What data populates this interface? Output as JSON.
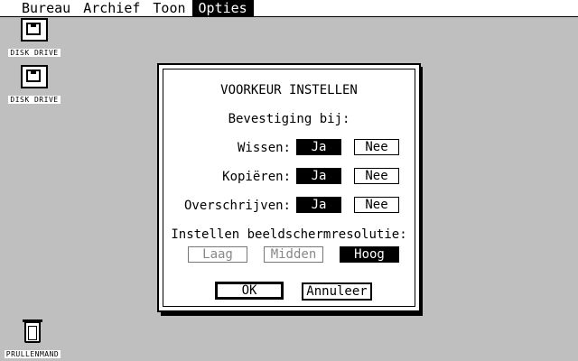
{
  "menu": {
    "items": [
      {
        "label": "Bureau"
      },
      {
        "label": "Archief"
      },
      {
        "label": "Toon"
      },
      {
        "label": "Opties"
      }
    ]
  },
  "desktop": {
    "drive_a": {
      "label": "DISK DRIVE",
      "icon": "floppy-drive-icon"
    },
    "drive_b": {
      "label": "DISK DRIVE",
      "icon": "floppy-drive-icon"
    },
    "trash": {
      "label": "PRULLENMAND",
      "icon": "trash-icon"
    }
  },
  "dialog": {
    "title": "VOORKEUR INSTELLEN",
    "confirm_heading": "Bevestiging bij:",
    "rows": [
      {
        "label": "Wissen:",
        "yes": "Ja",
        "no": "Nee",
        "selected": "yes"
      },
      {
        "label": "Kopiëren:",
        "yes": "Ja",
        "no": "Nee",
        "selected": "yes"
      },
      {
        "label": "Overschrijven:",
        "yes": "Ja",
        "no": "Nee",
        "selected": "yes"
      }
    ],
    "resolution_heading": "Instellen beeldschermresolutie:",
    "resolutions": [
      {
        "label": "Laag",
        "state": "disabled"
      },
      {
        "label": "Midden",
        "state": "disabled"
      },
      {
        "label": "Hoog",
        "state": "selected"
      }
    ],
    "ok_label": "OK",
    "cancel_label": "Annuleer"
  }
}
